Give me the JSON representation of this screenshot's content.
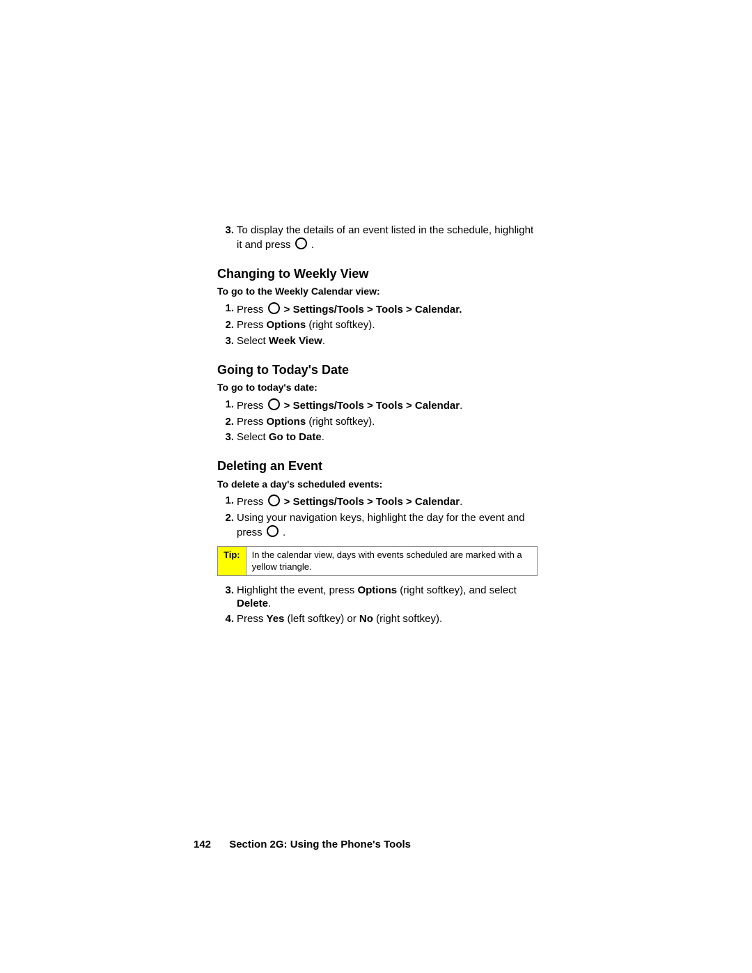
{
  "intro_step3_a": "To display the details of an event listed in the schedule, highlight it and press ",
  "intro_step3_b": " .",
  "h_weekly": "Changing to Weekly View",
  "sub_weekly": "To go to the Weekly Calendar view:",
  "w1_a": "Press ",
  "w1_b": "  >  Settings/Tools > Tools > Calendar.",
  "w2_a": "Press ",
  "w2_b": "Options",
  "w2_c": " (right softkey).",
  "w3_a": "Select ",
  "w3_b": "Week View",
  "w3_c": ".",
  "h_today": "Going to Today's Date",
  "sub_today": "To go to today's date:",
  "t1_a": "Press ",
  "t1_b": "  >  Settings/Tools > Tools > Calendar",
  "t1_c": ".",
  "t2_a": "Press ",
  "t2_b": "Options",
  "t2_c": " (right softkey).",
  "t3_a": "Select ",
  "t3_b": "Go to Date",
  "t3_c": ".",
  "h_delete": "Deleting an Event",
  "sub_delete": "To delete a day's scheduled events:",
  "d1_a": "Press ",
  "d1_b": "  >  Settings/Tools > Tools > Calendar",
  "d1_c": ".",
  "d2_a": "Using your navigation keys, highlight the day for the event and press ",
  "d2_b": " .",
  "tip_label": "Tip:",
  "tip_text": "In the calendar view, days with events scheduled are marked with a yellow triangle.",
  "d3_a": "Highlight the event, press ",
  "d3_b": "Options",
  "d3_c": " (right softkey), and select ",
  "d3_d": "Delete",
  "d3_e": ".",
  "d4_a": "Press ",
  "d4_b": "Yes",
  "d4_c": " (left softkey) or ",
  "d4_d": "No",
  "d4_e": " (right softkey).",
  "page_number": "142",
  "section_label": "Section 2G: Using the Phone's Tools",
  "nums": {
    "n1": "1.",
    "n2": "2.",
    "n3": "3.",
    "n4": "4."
  }
}
